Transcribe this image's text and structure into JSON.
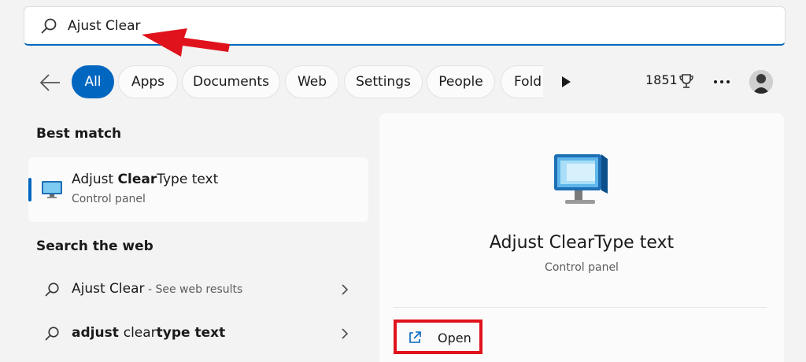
{
  "search": {
    "value": "Ajust Clear"
  },
  "filters": {
    "tabs": [
      {
        "label": "All",
        "active": true
      },
      {
        "label": "Apps"
      },
      {
        "label": "Documents"
      },
      {
        "label": "Web"
      },
      {
        "label": "Settings"
      },
      {
        "label": "People"
      },
      {
        "label": "Fold"
      }
    ],
    "points": "1851"
  },
  "best_match": {
    "heading": "Best match",
    "title_pre": "Adjust ",
    "title_bold": "Clear",
    "title_post": "Type text",
    "subtitle": "Control panel"
  },
  "web": {
    "heading": "Search the web",
    "rows": [
      {
        "text": "Ajust Clear",
        "hint": " - See web results"
      },
      {
        "bold_a": "adjust ",
        "normal": "clear",
        "bold_b": "type text"
      }
    ]
  },
  "preview": {
    "title": "Adjust ClearType text",
    "subtitle": "Control panel",
    "open_label": "Open"
  },
  "colors": {
    "accent": "#0067c0",
    "annotation_red": "#e0121c"
  }
}
